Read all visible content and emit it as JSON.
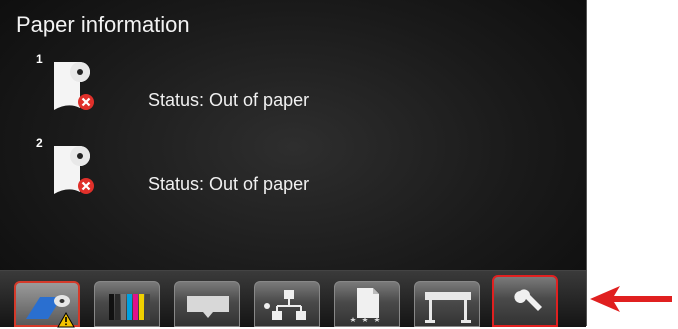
{
  "header": {
    "title": "Paper information"
  },
  "rolls": [
    {
      "number": "1",
      "status": "Status: Out of paper"
    },
    {
      "number": "2",
      "status": "Status: Out of paper"
    }
  ],
  "toolbar": {
    "buttons": [
      {
        "name": "paper",
        "icon": "paper-roll-warning-icon",
        "selected": true
      },
      {
        "name": "ink",
        "icon": "ink-cartridges-icon"
      },
      {
        "name": "output",
        "icon": "output-tray-icon"
      },
      {
        "name": "network",
        "icon": "network-icon"
      },
      {
        "name": "jobs",
        "icon": "job-queue-icon"
      },
      {
        "name": "printer",
        "icon": "printer-icon"
      },
      {
        "name": "setup",
        "icon": "wrench-icon",
        "highlighted": true
      }
    ]
  },
  "colors": {
    "error": "#e0302a",
    "highlight": "#e02020",
    "warning": "#f2c200"
  }
}
